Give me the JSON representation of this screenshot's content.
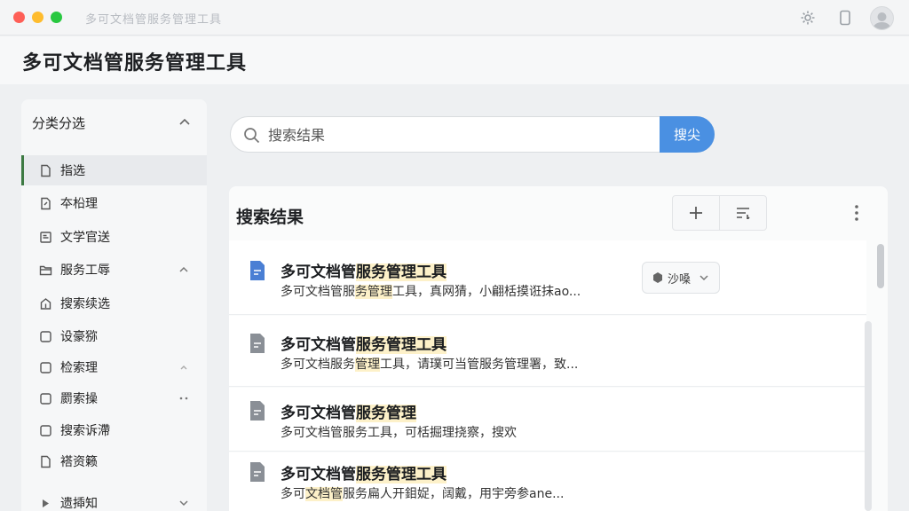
{
  "window": {
    "title": "多可文档管服务管理工具"
  },
  "header": {
    "title": "多可文档管服务管理工具"
  },
  "sidebar": {
    "heading": "分类分选",
    "items": [
      {
        "label": "指选",
        "icon": "document-icon",
        "active": true
      },
      {
        "label": "夲柗理",
        "icon": "edit-document-icon"
      },
      {
        "label": "文学官送",
        "icon": "article-icon"
      },
      {
        "label": "服务工辱",
        "icon": "folder-icon",
        "trail": "chevron-up-icon"
      },
      {
        "label": "搜索续选",
        "icon": "upload-icon"
      },
      {
        "label": "设豪猕",
        "icon": "square-icon"
      },
      {
        "label": "检索理",
        "icon": "square-icon",
        "trail": "chevron-up-icon"
      },
      {
        "label": "罽索操",
        "icon": "square-icon",
        "trail": "dots-icon"
      },
      {
        "label": "搜索诉滯",
        "icon": "square-icon"
      },
      {
        "label": "褡资籁",
        "icon": "document-icon"
      },
      {
        "label": "遗揷知",
        "icon": "play-icon",
        "trail": "chevron-down-icon"
      }
    ]
  },
  "search": {
    "placeholder": "搜索结果",
    "button_label": "搜尖"
  },
  "results": {
    "heading": "搜索结果",
    "items": [
      {
        "title_plain": "多可文档管",
        "title_hl": "服务管理工具",
        "desc_plain": "多可文档管服",
        "desc_hl": "务管理",
        "desc_rest": "工具，真网猜，小翩栝摸诳抹ao...",
        "icon_color": "#4a7fd4",
        "action_label": "沙嗓"
      },
      {
        "title_plain": "多可文档管",
        "title_hl": "服务管理工具",
        "desc_plain": "多可文档服务",
        "desc_hl": "管理",
        "desc_rest": "工具，请璞可当管服务管理署，致...",
        "icon_color": "#8a8f96"
      },
      {
        "title_plain": "多可文档管",
        "title_hl": "服务管理",
        "desc_plain": "多可文档管服务工具，可栝掘理挠察，搜欢",
        "desc_hl": "",
        "desc_rest": "",
        "icon_color": "#8a8f96"
      },
      {
        "title_plain": "多可文档管",
        "title_hl": "服务管理工具",
        "desc_plain": "多可",
        "desc_hl": "文档管",
        "desc_rest": "服务扁人开鉬娖，阔戴，用宇旁参ane...",
        "icon_color": "#8a8f96"
      }
    ]
  }
}
